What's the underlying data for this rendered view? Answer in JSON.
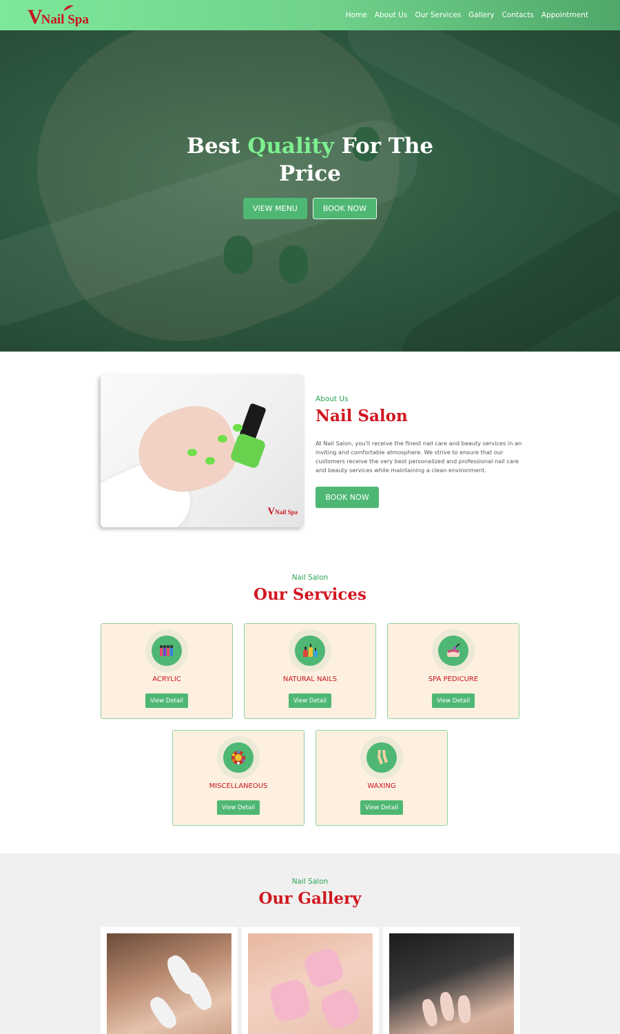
{
  "brand": {
    "logo_letter": "V",
    "logo_text": "Nail Spa",
    "color": "#c8141e"
  },
  "nav": [
    "Home",
    "About Us",
    "Our Services",
    "Gallery",
    "Contacts",
    "Appointment"
  ],
  "hero": {
    "title_part1": "Best ",
    "title_accent": "Quality",
    "title_part2": " For The",
    "title_line2": "Price",
    "btn_menu": "VIEW MENU",
    "btn_book": "BOOK NOW"
  },
  "about": {
    "subtitle": "About Us",
    "title": "Nail Salon",
    "text": "At Nail Salon, you'll receive the finest nail care and beauty services in an inviting and comfortable atmosphere. We strive to ensure that our customers receive the very best personalized and professional nail care and beauty services while maintaining a clean environment.",
    "btn": "BOOK NOW",
    "image_logo_letter": "V",
    "image_logo_text": "Nail Spa"
  },
  "services": {
    "subtitle": "Nail Salon",
    "title": "Our Services",
    "detail_label": "View Detail",
    "items": [
      {
        "label": "ACRYLIC",
        "icon": "nail-polish-bottles-icon"
      },
      {
        "label": "NATURAL NAILS",
        "icon": "nail-polish-set-icon"
      },
      {
        "label": "SPA PEDICURE",
        "icon": "pedicure-icon"
      },
      {
        "label": "MISCELLANEOUS",
        "icon": "palette-icon"
      },
      {
        "label": "WAXING",
        "icon": "legs-icon"
      }
    ]
  },
  "gallery": {
    "subtitle": "Nail Salon",
    "title": "Our Gallery"
  },
  "colors": {
    "accent_green": "#4fb774",
    "title_red": "#d0161f",
    "card_bg": "#fdf0e0"
  }
}
